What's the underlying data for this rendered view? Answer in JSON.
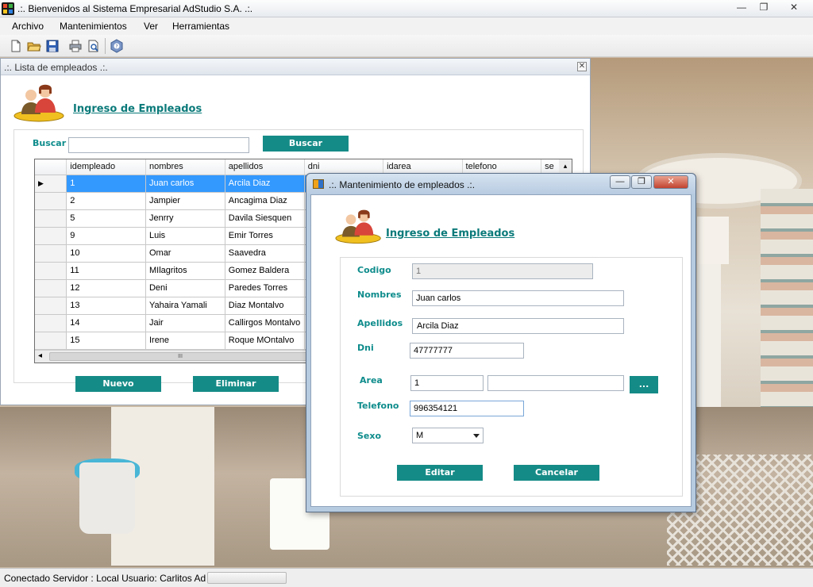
{
  "window": {
    "title": ".:. Bienvenidos al Sistema Empresarial AdStudio S.A. .:.",
    "min_glyph": "—",
    "max_glyph": "❐",
    "close_glyph": "✕"
  },
  "menubar": {
    "items": [
      "Archivo",
      "Mantenimientos",
      "Ver",
      "Herramientas"
    ]
  },
  "toolbar": {
    "buttons": [
      "new-document-icon",
      "open-folder-icon",
      "save-icon",
      "print-icon",
      "print-preview-icon",
      "help-icon"
    ]
  },
  "lista": {
    "title": ".:. Lista de empleados .:.",
    "close_glyph": "✕",
    "heading": "Ingreso de Empleados",
    "search_label": "Buscar",
    "search_value": "",
    "search_button": "Buscar",
    "columns": [
      "idempleado",
      "nombres",
      "apellidos",
      "dni",
      "idarea",
      "telefono",
      "se"
    ],
    "rows": [
      [
        "1",
        "Juan carlos",
        "Arcila Diaz"
      ],
      [
        "2",
        "Jampier",
        "Ancagima Diaz"
      ],
      [
        "5",
        "Jenrry",
        "Davila Siesquen"
      ],
      [
        "9",
        "Luis",
        "Emir Torres"
      ],
      [
        "10",
        "Omar",
        "Saavedra"
      ],
      [
        "11",
        "MIlagritos",
        "Gomez Baldera"
      ],
      [
        "12",
        "Deni",
        "Paredes Torres"
      ],
      [
        "13",
        "Yahaira Yamali",
        "Diaz Montalvo"
      ],
      [
        "14",
        "Jair",
        "Callirgos Montalvo"
      ],
      [
        "15",
        "Irene",
        "Roque MOntalvo"
      ]
    ],
    "selected_row": 0,
    "row_pointer": "▶",
    "scroll_left": "◂",
    "scroll_up": "▴",
    "scroll_thumb_glyph": "III",
    "new_button": "Nuevo",
    "delete_button": "Eliminar"
  },
  "dialog": {
    "title": ".:. Mantenimiento de empleados .:.",
    "min_glyph": "—",
    "max_glyph": "❐",
    "close_glyph": "✕",
    "heading": "Ingreso de Empleados",
    "fields": {
      "codigo_label": "Codigo",
      "codigo_value": "1",
      "nombres_label": "Nombres",
      "nombres_value": "Juan carlos",
      "apellidos_label": "Apellidos",
      "apellidos_value": "Arcila Diaz",
      "dni_label": "Dni",
      "dni_value": "47777777",
      "area_label": "Area",
      "area_value": "1",
      "area_name": "",
      "area_browse": "...",
      "telefono_label": "Telefono",
      "telefono_value": "996354121",
      "sexo_label": "Sexo",
      "sexo_value": "M"
    },
    "edit_button": "Editar",
    "cancel_button": "Cancelar"
  },
  "statusbar": {
    "text": "Conectado Servidor : Local  Usuario: Carlitos Ad"
  },
  "colors": {
    "accent": "#158b87",
    "heading": "#0b7a7a",
    "selection": "#3399ff"
  }
}
